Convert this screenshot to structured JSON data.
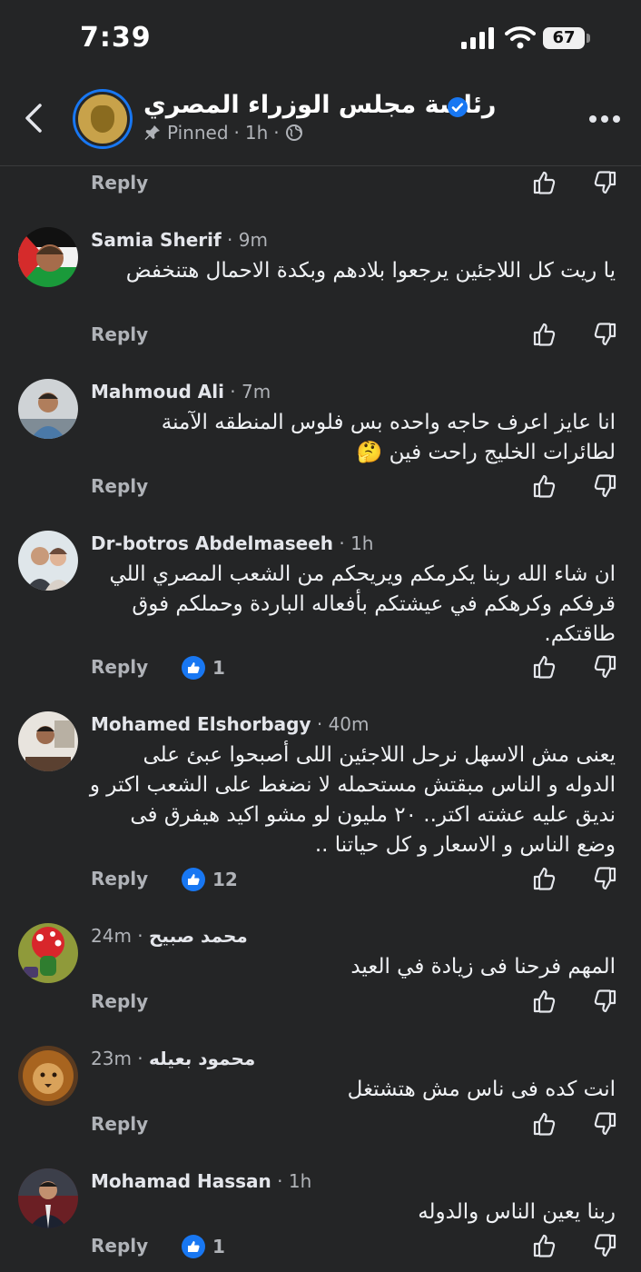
{
  "status_bar": {
    "time": "7:39",
    "battery": "67"
  },
  "header": {
    "page_name": "رئاسة مجلس الوزراء المصري",
    "pinned": "Pinned",
    "sep": "·",
    "age": "1h"
  },
  "labels": {
    "reply": "Reply"
  },
  "comments": [
    {
      "name": "Samia Sherif",
      "time": "9m",
      "text": "يا ريت كل اللاجئين يرجعوا بلادهم وبكدة الاحمال هتنخفض"
    },
    {
      "name": "Mahmoud Ali",
      "time": "7m",
      "text": "انا عايز اعرف حاجه واحده بس فلوس المنطقه الآمنة لطائرات الخليج راحت فين 🤔"
    },
    {
      "name": "Dr-botros Abdelmaseeh",
      "time": "1h",
      "text": "ان شاء الله ربنا يكرمكم ويريحكم من الشعب المصري اللي قرفكم وكرهكم في عيشتكم بأفعاله الباردة وحملكم فوق طاقتكم.",
      "likes": "1"
    },
    {
      "name": "Mohamed Elshorbagy",
      "time": "40m",
      "text": "يعنى مش الاسهل نرحل اللاجئين اللى أصبحوا عبئ على الدوله و الناس مبقتش مستحمله لا نضغط على الشعب اكتر و نديق عليه عشته اكتر.. ٢٠ مليون لو مشو اكيد هيفرق فى وضع الناس و الاسعار و كل حياتنا ..",
      "likes": "12"
    },
    {
      "name": "محمد صبيح",
      "time": "24m",
      "text": "المهم فرحنا   فى زيادة في العيد"
    },
    {
      "name": "محمود بعيله",
      "time": "23m",
      "text": "انت كده فى ناس مش هتشتغل"
    },
    {
      "name": "Mohamad Hassan",
      "time": "1h",
      "text": "ربنا يعين الناس والدوله",
      "likes": "1"
    }
  ]
}
